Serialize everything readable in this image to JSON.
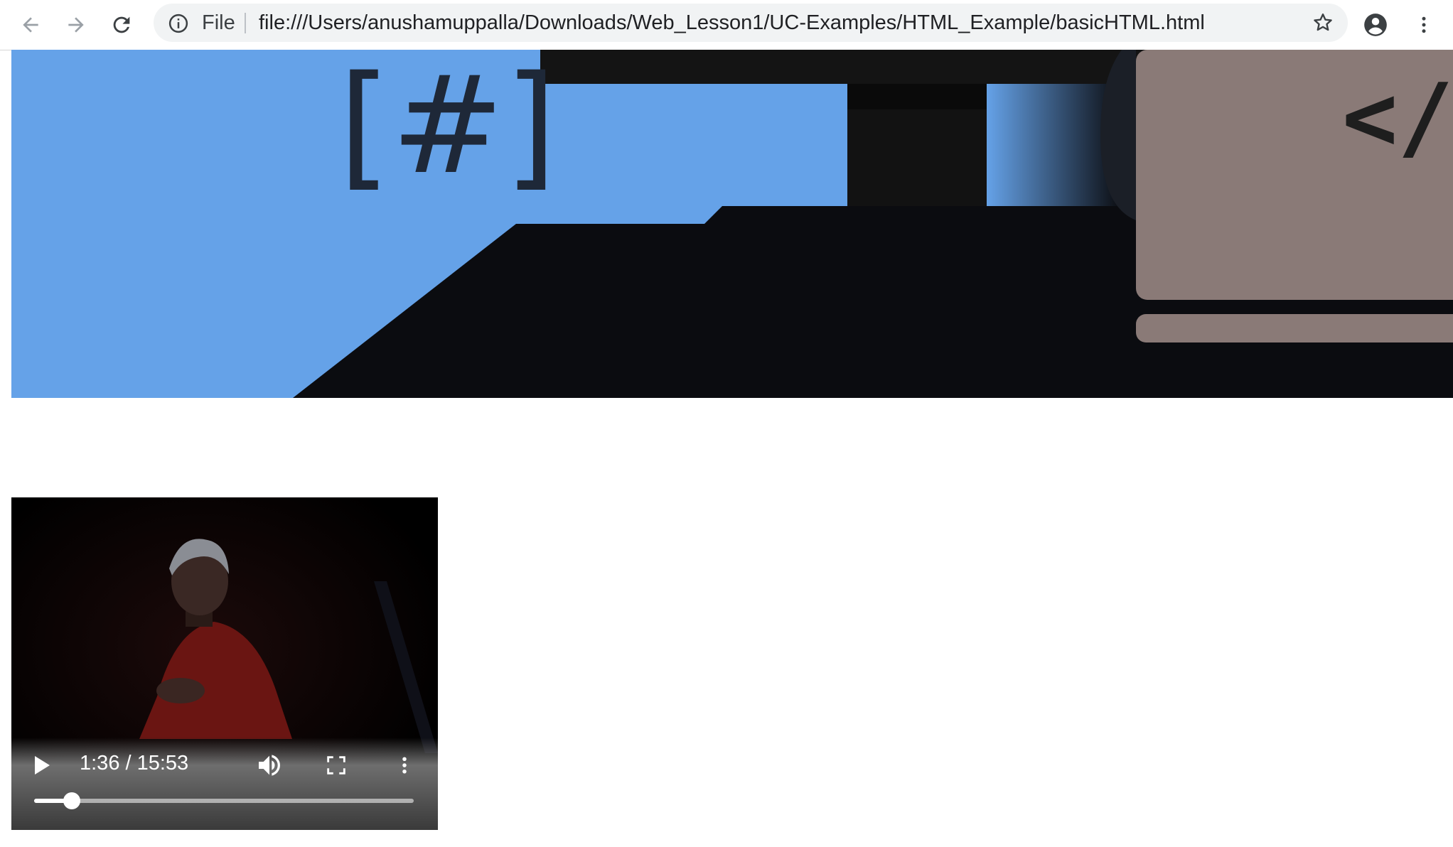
{
  "browser": {
    "scheme_label": "File",
    "url": "file:///Users/anushamuppalla/Downloads/Web_Lesson1/UC-Examples/HTML_Example/basicHTML.html",
    "icons": {
      "back": "arrow-left-icon",
      "forward": "arrow-right-icon",
      "reload": "reload-icon",
      "info": "info-circle-icon",
      "bookmark": "star-icon",
      "profile": "account-circle-icon",
      "menu": "more-vert-icon"
    }
  },
  "banner": {
    "glyph_left": "[#]",
    "glyph_right": "</",
    "colors": {
      "sky": "#65a2e8",
      "dark": "#0b0c10",
      "laptop": "#8a7a77"
    }
  },
  "video": {
    "time": "1:36 / 15:53",
    "progress": 0.1,
    "icons": {
      "play": "play-icon",
      "volume": "volume-icon",
      "fullscreen": "fullscreen-icon",
      "more": "more-vert-icon"
    }
  }
}
